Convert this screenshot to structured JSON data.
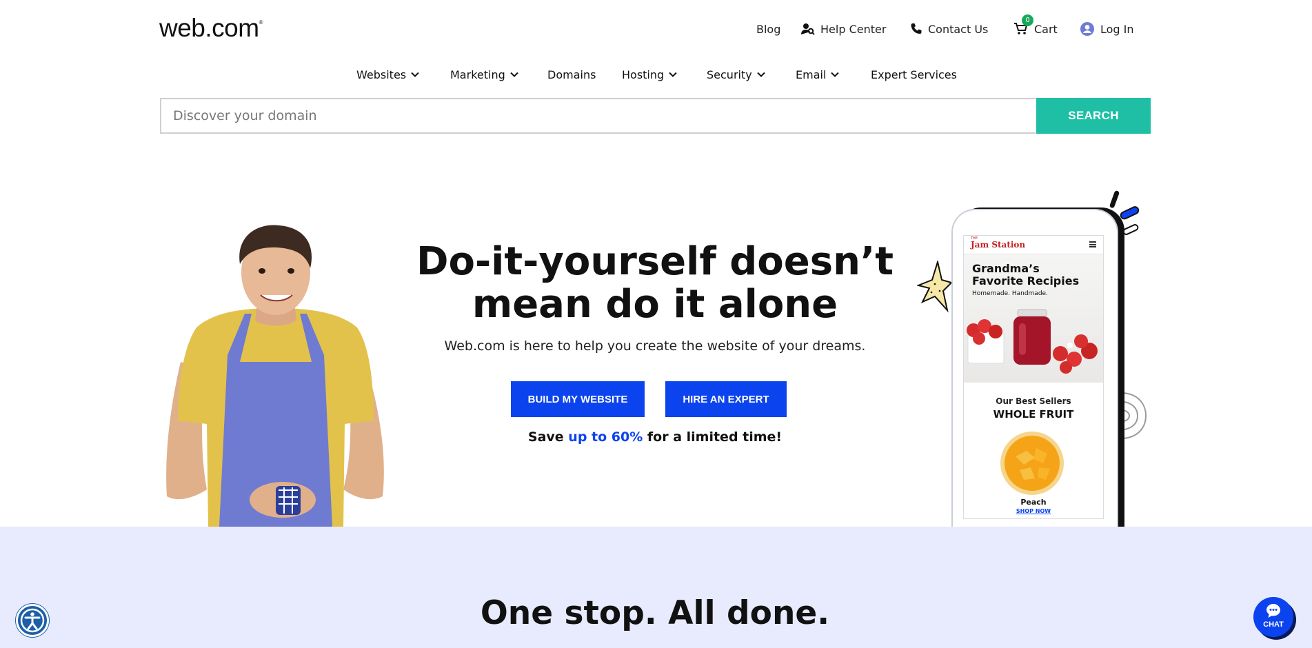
{
  "header": {
    "logo": "web.com",
    "logo_mark": "®",
    "utility": {
      "blog": "Blog",
      "help": "Help Center",
      "contact": "Contact Us",
      "cart_count": "0",
      "cart": "Cart",
      "login": "Log In"
    },
    "nav": {
      "websites": "Websites",
      "marketing": "Marketing",
      "domains": "Domains",
      "hosting": "Hosting",
      "security": "Security",
      "email": "Email",
      "expert": "Expert Services"
    }
  },
  "search": {
    "placeholder": "Discover your domain",
    "button": "SEARCH"
  },
  "hero": {
    "title_line1": "Do-it-yourself doesn’t",
    "title_line2": "mean do it alone",
    "subtitle": "Web.com is here to help you create the website of your dreams.",
    "cta_primary": "BUILD MY WEBSITE",
    "cta_secondary": "HIRE AN EXPERT",
    "promo_pre": "Save ",
    "promo_highlight": "up to 60%",
    "promo_post": " for a limited time!"
  },
  "phone": {
    "brand_small": "THE",
    "brand": "Jam Station",
    "title_line1": "Grandma’s",
    "title_line2": "Favorite Recipies",
    "tagline": "Homemade. Handmade.",
    "best_sellers": "Our Best Sellers",
    "category": "WHOLE FRUIT",
    "product": "Peach",
    "shop_link": "SHOP NOW"
  },
  "section": {
    "title": "One stop. All done."
  },
  "widgets": {
    "chat_label": "CHAT"
  },
  "colors": {
    "primary_blue": "#0b43ee",
    "teal": "#1fbfa6",
    "band": "#e7ebfd",
    "cart_badge": "#17a85c"
  },
  "icons": [
    "help-person-icon",
    "phone-icon",
    "cart-icon",
    "user-circle-icon",
    "chevron-down-icon",
    "accessibility-icon",
    "chat-bubble-icon"
  ]
}
